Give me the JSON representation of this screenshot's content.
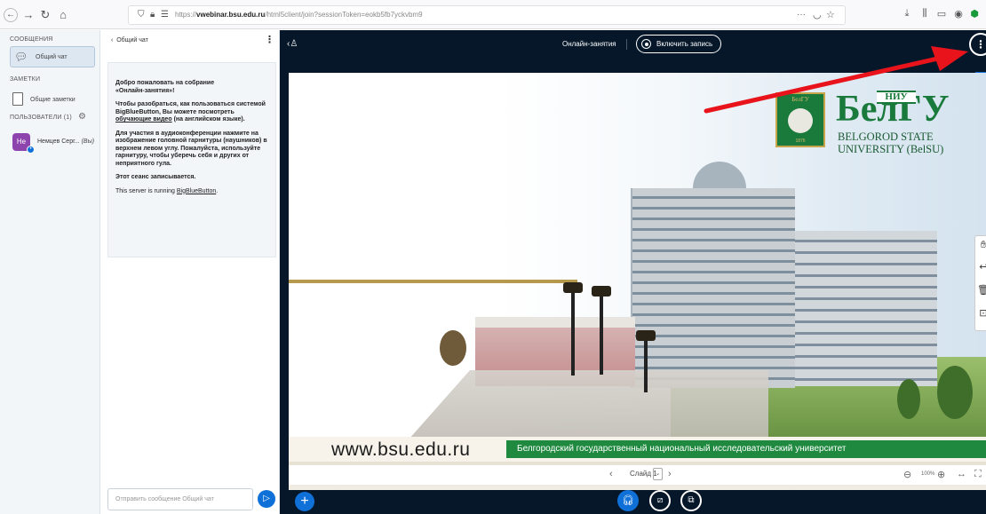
{
  "browser": {
    "back_icon": "arrow-left-icon",
    "forward_icon": "arrow-right-icon",
    "reload_icon": "reload-icon",
    "home_icon": "home-icon",
    "url_prefix": "https://",
    "url_domain": "vwebinar.bsu.edu.ru",
    "url_path": "/html5client/join?sessionToken=eokb5fb7yckvbm9",
    "toolbar_icons": [
      "download-icon",
      "library-icon",
      "sidebar-icon",
      "account-icon",
      "extension-icon"
    ]
  },
  "sidebar": {
    "messages_heading": "СООБЩЕНИЯ",
    "public_chat_label": "Общий чат",
    "notes_heading": "ЗАМЕТКИ",
    "shared_notes_label": "Общие заметки",
    "users_heading": "ПОЛЬЗОВАТЕЛИ (1)",
    "user": {
      "initials": "Не",
      "name": "Немцев Серг...",
      "you_tag": "(Вы)"
    }
  },
  "chat": {
    "back_label": "Общий чат",
    "welcome_line1": "Добро пожаловать на собрание",
    "welcome_line2": "«Онлайн-занятия»!",
    "help_part1": "Чтобы разобраться, как пользоваться системой BigBlueButton, Вы можете посмотреть",
    "help_link": "обучающие видео",
    "help_part2": "(на английском языке).",
    "audio_tip": "Для участия в аудиоконференции нажмите на изображение головной гарнитуры (наушников) в верхнем левом углу. Пожалуйста, используйте гарнитуру, чтобы уберечь себя и других от неприятного гула.",
    "recording_note": "Этот сеанс записывается.",
    "server_prefix": "This server is running",
    "server_link": "BigBlueButton",
    "server_suffix": ".",
    "input_placeholder": "Отправить сообщение Общий чат"
  },
  "main": {
    "meeting_title": "Онлайн-занятия",
    "record_label": "Включить запись",
    "slide_label": "Слайд 1",
    "zoom_value": "100%"
  },
  "slide": {
    "logo_box_text": "БелГУ",
    "logo_year": "1876",
    "logo_niu": "НИУ",
    "logo_big": "БелГУ",
    "logo_en_line1": "BELGOROD STATE",
    "logo_en_line2": "UNIVERSITY (BelSU)",
    "footer_url": "www.bsu.edu.ru",
    "footer_text": "Белгородский государственный национальный исследовательский университет"
  },
  "colors": {
    "bbb_blue": "#0f70d7",
    "main_bg": "#06172a",
    "belsu_green": "#1a7a3c",
    "annotation_red": "#e8131b"
  }
}
